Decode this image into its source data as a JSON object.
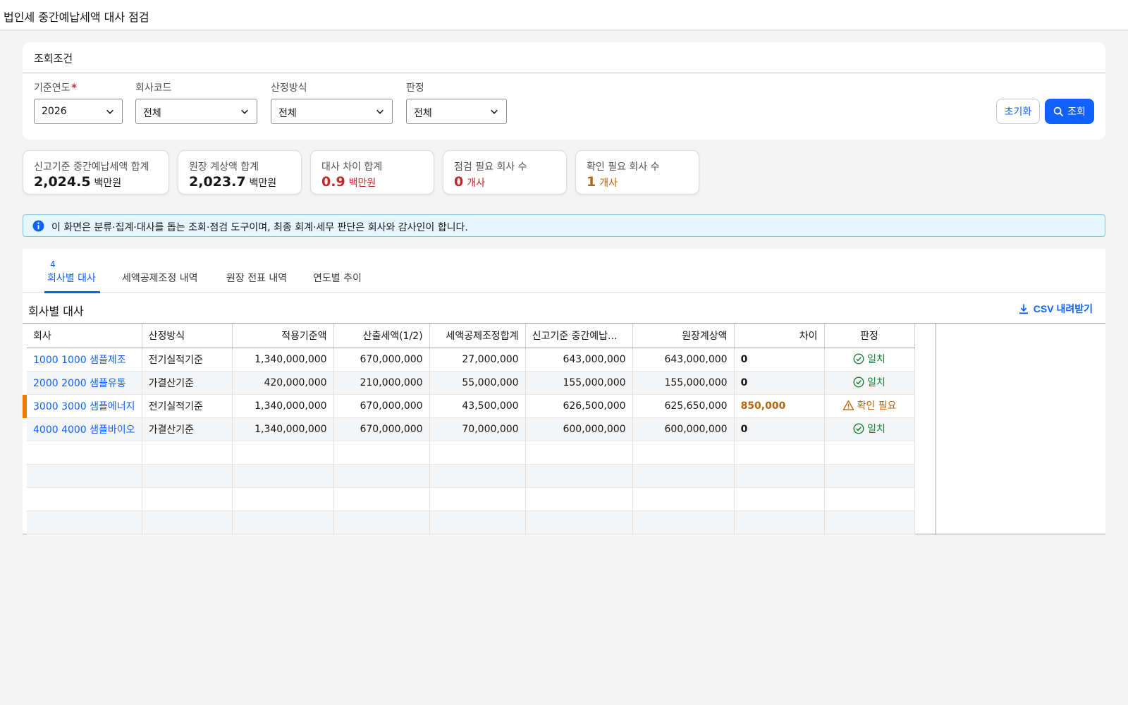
{
  "page": {
    "title": "법인세 중간예납세액 대사 점검"
  },
  "filters": {
    "section_title": "조회조건",
    "year": {
      "label": "기준연도",
      "required_mark": "*",
      "value": "2026"
    },
    "company": {
      "label": "회사코드",
      "value": "전체"
    },
    "method": {
      "label": "산정방식",
      "value": "전체"
    },
    "verdict": {
      "label": "판정",
      "value": "전체"
    },
    "reset_label": "초기화",
    "search_label": "조회"
  },
  "summary": [
    {
      "label": "신고기준 중간예납세액 합계",
      "value": "2,024.5",
      "unit": "백만원",
      "color": "#161616"
    },
    {
      "label": "원장 계상액 합계",
      "value": "2,023.7",
      "unit": "백만원",
      "color": "#161616"
    },
    {
      "label": "대사 차이 합계",
      "value": "0.9",
      "unit": "백만원",
      "color": "#c62828"
    },
    {
      "label": "점검 필요 회사 수",
      "value": "0",
      "unit": "개사",
      "color": "#c62828"
    },
    {
      "label": "확인 필요 회사 수",
      "value": "1",
      "unit": "개사",
      "color": "#b8630b"
    }
  ],
  "notice": {
    "text": "이 화면은 분류·집계·대사를 돕는 조회·점검 도구이며, 최종 회계·세무 판단은 회사와 감사인이 합니다."
  },
  "tabs": [
    {
      "label": "회사별 대사",
      "count": "4",
      "active": true
    },
    {
      "label": "세액공제조정 내역",
      "count": "",
      "active": false
    },
    {
      "label": "원장 전표 내역",
      "count": "",
      "active": false
    },
    {
      "label": "연도별 추이",
      "count": "",
      "active": false
    }
  ],
  "grid": {
    "title": "회사별 대사",
    "csv_label": "CSV 내려받기",
    "columns": [
      "회사",
      "산정방식",
      "적용기준액",
      "산출세액(1/2)",
      "세액공제조정합계",
      "신고기준 중간예납...",
      "원장계상액",
      "차이",
      "판정"
    ],
    "rows": [
      {
        "company": "1000 1000 샘플제조",
        "method": "전기실적기준",
        "base": "1,340,000,000",
        "calc": "670,000,000",
        "credit": "27,000,000",
        "filed": "643,000,000",
        "ledger": "643,000,000",
        "diff": "0",
        "verdict": "일치",
        "status": "ok"
      },
      {
        "company": "2000 2000 샘플유통",
        "method": "가결산기준",
        "base": "420,000,000",
        "calc": "210,000,000",
        "credit": "55,000,000",
        "filed": "155,000,000",
        "ledger": "155,000,000",
        "diff": "0",
        "verdict": "일치",
        "status": "ok"
      },
      {
        "company": "3000 3000 샘플에너지",
        "method": "전기실적기준",
        "base": "1,340,000,000",
        "calc": "670,000,000",
        "credit": "43,500,000",
        "filed": "626,500,000",
        "ledger": "625,650,000",
        "diff": "850,000",
        "verdict": "확인 필요",
        "status": "warn"
      },
      {
        "company": "4000 4000 샘플바이오",
        "method": "가결산기준",
        "base": "1,340,000,000",
        "calc": "670,000,000",
        "credit": "70,000,000",
        "filed": "600,000,000",
        "ledger": "600,000,000",
        "diff": "0",
        "verdict": "일치",
        "status": "ok"
      }
    ]
  },
  "colors": {
    "accent": "#0f62fe",
    "ok": "#198038",
    "warn": "#b8630b",
    "error": "#c62828",
    "row_flag": "#e67e00"
  }
}
